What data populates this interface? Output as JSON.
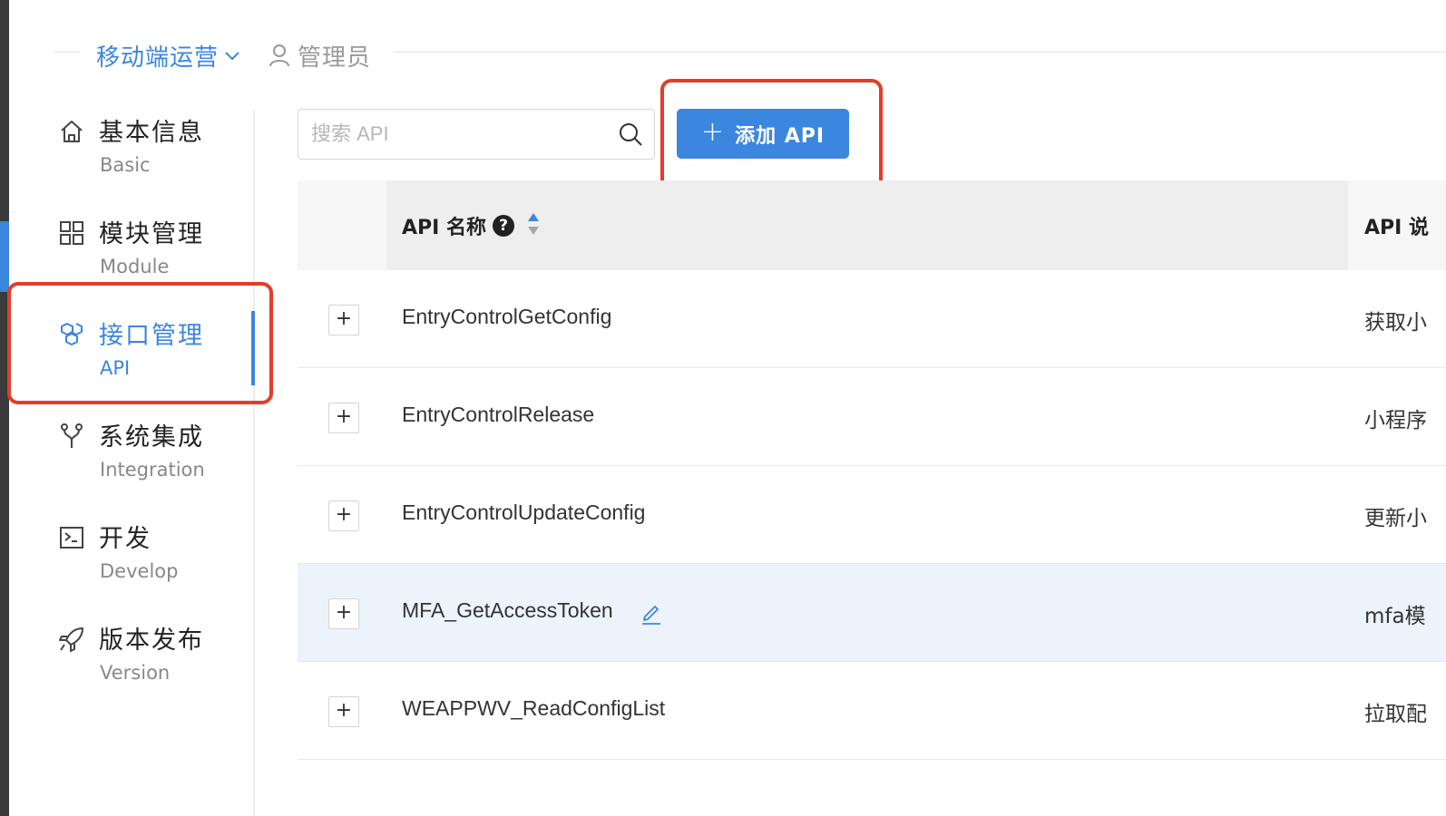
{
  "header": {
    "project_name": "移动端运营",
    "role": "管理员"
  },
  "sidebar": {
    "items": [
      {
        "label": "基本信息",
        "sub": "Basic",
        "icon": "home-icon"
      },
      {
        "label": "模块管理",
        "sub": "Module",
        "icon": "grid-icon"
      },
      {
        "label": "接口管理",
        "sub": "API",
        "icon": "api-cubes-icon",
        "active": true
      },
      {
        "label": "系统集成",
        "sub": "Integration",
        "icon": "fork-icon"
      },
      {
        "label": "开发",
        "sub": "Develop",
        "icon": "terminal-icon"
      },
      {
        "label": "版本发布",
        "sub": "Version",
        "icon": "rocket-icon"
      }
    ]
  },
  "toolbar": {
    "search_placeholder": "搜索 API",
    "add_label": "添加 API"
  },
  "table": {
    "columns": {
      "name": "API 名称",
      "help": "?",
      "desc": "API 说"
    },
    "rows": [
      {
        "name": "EntryControlGetConfig",
        "desc": "获取小"
      },
      {
        "name": "EntryControlRelease",
        "desc": "小程序"
      },
      {
        "name": "EntryControlUpdateConfig",
        "desc": "更新小"
      },
      {
        "name": "MFA_GetAccessToken",
        "desc": "mfa模"
      },
      {
        "name": "WEAPPWV_ReadConfigList",
        "desc": "拉取配"
      }
    ]
  },
  "colors": {
    "accent": "#3b86de",
    "highlight": "#e23d2b",
    "row_hover": "#edf3fb"
  }
}
